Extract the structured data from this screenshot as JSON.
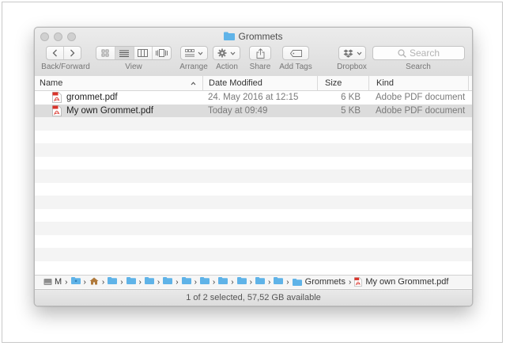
{
  "window": {
    "title": "Grommets"
  },
  "toolbar": {
    "back_forward_label": "Back/Forward",
    "view_label": "View",
    "arrange_label": "Arrange",
    "action_label": "Action",
    "share_label": "Share",
    "add_tags_label": "Add Tags",
    "dropbox_label": "Dropbox",
    "search_label": "Search",
    "search_placeholder": "Search"
  },
  "columns": {
    "name": "Name",
    "date": "Date Modified",
    "size": "Size",
    "kind": "Kind"
  },
  "files": [
    {
      "name": "grommet.pdf",
      "date": "24. May 2016 at 12:15",
      "size": "6 KB",
      "kind": "Adobe PDF document",
      "selected": false
    },
    {
      "name": "My own Grommet.pdf",
      "date": "Today at 09:49",
      "size": "5 KB",
      "kind": "Adobe PDF document",
      "selected": true
    }
  ],
  "pathbar": {
    "disk_label": "M",
    "folder_label": "Grommets",
    "file_label": "My own Grommet.pdf"
  },
  "status": {
    "text": "1 of 2 selected, 57,52 GB available"
  },
  "colors": {
    "folder": "#5fb3e8",
    "pdf_red": "#d9342b",
    "selection": "#dcdcdc"
  }
}
